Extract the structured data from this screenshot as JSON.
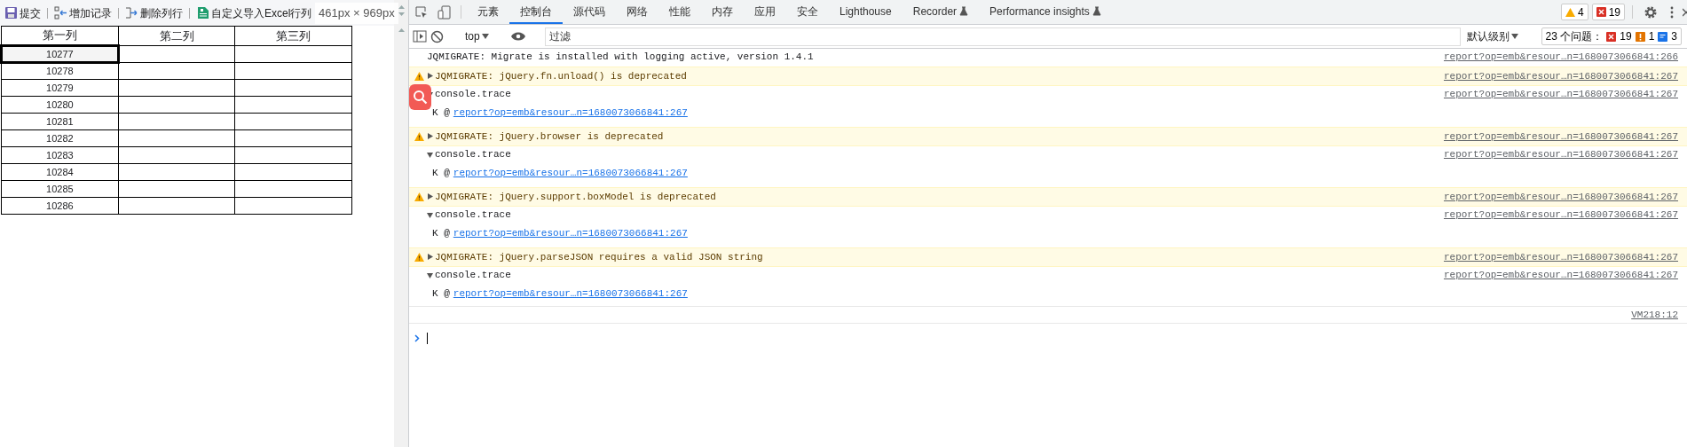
{
  "page": {
    "toolbar": [
      {
        "kind": "save",
        "label": "提交"
      },
      {
        "kind": "add",
        "label": "增加记录"
      },
      {
        "kind": "delete",
        "label": "删除列行"
      },
      {
        "kind": "excel",
        "label": "自定义导入Excel行列"
      }
    ],
    "size_tooltip": "461px × 969px",
    "table": {
      "columns": [
        "第一列",
        "第二列",
        "第三列"
      ],
      "rows": [
        {
          "column_1": "10277",
          "selected": true
        },
        {
          "column_1": "10278",
          "selected": false
        },
        {
          "column_1": "10279",
          "selected": false
        },
        {
          "column_1": "10280",
          "selected": false
        },
        {
          "column_1": "10281",
          "selected": false
        },
        {
          "column_1": "10282",
          "selected": false
        },
        {
          "column_1": "10283",
          "selected": false
        },
        {
          "column_1": "10284",
          "selected": false
        },
        {
          "column_1": "10285",
          "selected": false
        },
        {
          "column_1": "10286",
          "selected": false
        }
      ]
    }
  },
  "devtools": {
    "tabs": [
      {
        "label": "元素",
        "selected": false,
        "experimental": false
      },
      {
        "label": "控制台",
        "selected": true,
        "experimental": false
      },
      {
        "label": "源代码",
        "selected": false,
        "experimental": false
      },
      {
        "label": "网络",
        "selected": false,
        "experimental": false
      },
      {
        "label": "性能",
        "selected": false,
        "experimental": false
      },
      {
        "label": "内存",
        "selected": false,
        "experimental": false
      },
      {
        "label": "应用",
        "selected": false,
        "experimental": false
      },
      {
        "label": "安全",
        "selected": false,
        "experimental": false
      },
      {
        "label": "Lighthouse",
        "selected": false,
        "experimental": false
      },
      {
        "label": "Recorder",
        "selected": false,
        "experimental": true
      },
      {
        "label": "Performance insights",
        "selected": false,
        "experimental": true
      }
    ],
    "warning_count": "4",
    "error_count": "19",
    "console_toolbar": {
      "context": "top",
      "filter_placeholder": "过滤",
      "level": "默认级别",
      "issues_label": "23 个问题：",
      "issues_errors": "19",
      "issues_warnings": "1",
      "issues_info": "3"
    },
    "messages": [
      {
        "kind": "log",
        "text": "JQMIGRATE: Migrate is installed with logging active, version 1.4.1",
        "source": "report?op=emb&resour…n=1680073066841:266"
      },
      {
        "kind": "warning",
        "expanded": false,
        "text": "JQMIGRATE: jQuery.fn.unload() is deprecated",
        "source": "report?op=emb&resour…n=1680073066841:267"
      },
      {
        "kind": "trace",
        "expanded": true,
        "text": "console.trace",
        "source": "report?op=emb&resour…n=1680073066841:267",
        "frames": [
          {
            "function": "K @",
            "link": "report?op=emb&resour…n=1680073066841:267"
          }
        ]
      },
      {
        "kind": "warning",
        "expanded": false,
        "text": "JQMIGRATE: jQuery.browser is deprecated",
        "source": "report?op=emb&resour…n=1680073066841:267"
      },
      {
        "kind": "trace",
        "expanded": true,
        "text": "console.trace",
        "source": "report?op=emb&resour…n=1680073066841:267",
        "frames": [
          {
            "function": "K @",
            "link": "report?op=emb&resour…n=1680073066841:267"
          }
        ]
      },
      {
        "kind": "warning",
        "expanded": false,
        "text": "JQMIGRATE: jQuery.support.boxModel is deprecated",
        "source": "report?op=emb&resour…n=1680073066841:267"
      },
      {
        "kind": "trace",
        "expanded": true,
        "text": "console.trace",
        "source": "report?op=emb&resour…n=1680073066841:267",
        "frames": [
          {
            "function": "K @",
            "link": "report?op=emb&resour…n=1680073066841:267"
          }
        ]
      },
      {
        "kind": "warning",
        "expanded": false,
        "text": "JQMIGRATE: jQuery.parseJSON requires a valid JSON string",
        "source": "report?op=emb&resour…n=1680073066841:267"
      },
      {
        "kind": "trace",
        "expanded": true,
        "text": "console.trace",
        "source": "report?op=emb&resour…n=1680073066841:267",
        "frames": [
          {
            "function": "K @",
            "link": "report?op=emb&resour…n=1680073066841:267"
          }
        ]
      },
      {
        "kind": "source_only",
        "source": "VM218:12"
      }
    ]
  }
}
